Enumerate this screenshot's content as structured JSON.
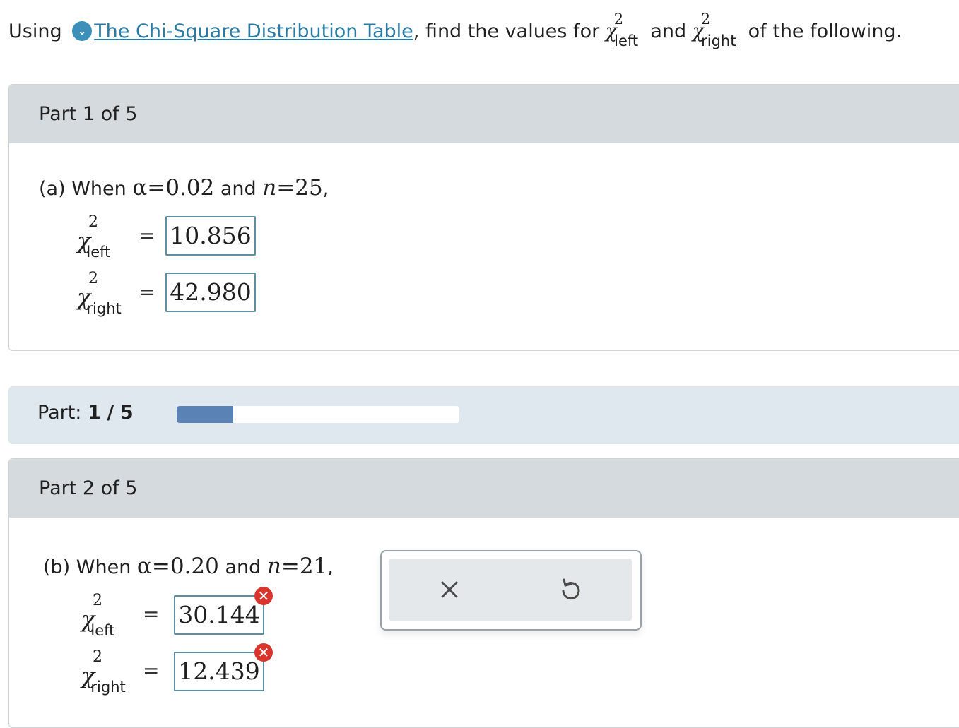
{
  "intro": {
    "prefix": "Using",
    "link": "The Chi-Square Distribution Table",
    "middle": ", find the values for",
    "and": "and",
    "suffix": "of the following.",
    "chi_symbol": "χ",
    "exponent": "2",
    "left_sub": "left",
    "right_sub": "right",
    "chevron_icon": "chevron-down-circle-icon"
  },
  "part1": {
    "header": "Part 1 of 5",
    "prefix": "(a) When",
    "alpha_sym": "α",
    "eq": "=",
    "alpha_val": "0.02",
    "and": "and",
    "n_sym": "n",
    "n_val": "25",
    "comma": ",",
    "left_value": "10.856",
    "right_value": "42.980"
  },
  "progress": {
    "label": "Part:",
    "current": "1",
    "sep": "/",
    "total": "5",
    "fraction": 0.2,
    "color": "#5b82b4"
  },
  "part2": {
    "header": "Part 2 of 5",
    "prefix": "(b) When",
    "alpha_sym": "α",
    "eq": "=",
    "alpha_val": "0.20",
    "and": "and",
    "n_sym": "n",
    "n_val": "21",
    "comma": ",",
    "left_value": "30.144",
    "right_value": "12.439",
    "error_icon": "error-x-icon"
  },
  "actions": {
    "clear_icon": "close-icon",
    "undo_icon": "undo-icon"
  }
}
